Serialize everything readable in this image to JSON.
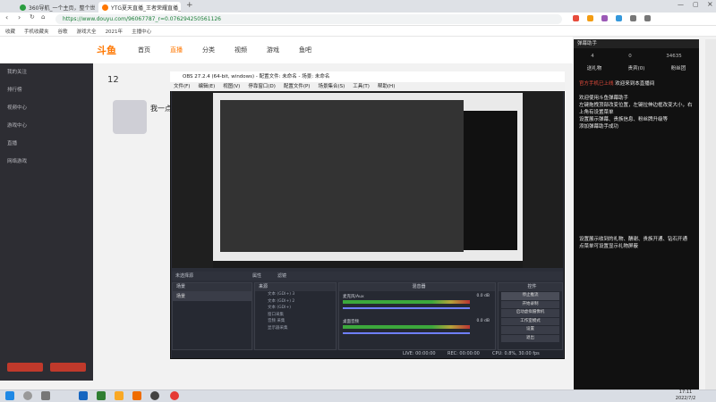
{
  "browser": {
    "tabs": [
      {
        "title": "360导航_一个主页，整个世界",
        "active": false
      },
      {
        "title": "YTG夏天直播_王者荣耀直播_",
        "active": true
      }
    ],
    "url": "https://www.douyu.com/96067787_r=0.076294250561126",
    "bookmarks": [
      "收藏",
      "手机收藏夹",
      "谷歌",
      "游戏大全",
      "2021年",
      "主播中心"
    ]
  },
  "douyu": {
    "logo": "斗鱼",
    "nav": [
      "首页",
      "直播",
      "分类",
      "视频",
      "游戏",
      "鱼吧"
    ],
    "left_menu": [
      "我的关注",
      "排行榜",
      "视频中心",
      "游戏中心",
      "直播",
      "网络游戏"
    ],
    "room_number": "12",
    "room_title": "我一点",
    "chat": {
      "title": "弹幕助手",
      "tabs": [
        "送礼物",
        "贵宾(0)",
        "粉丝团"
      ],
      "stats": [
        "4",
        "0",
        "34635"
      ],
      "alert": "官方手机已上线",
      "messages": [
        "欢迎来到本直播间",
        "欢迎使用斗鱼弹幕助手",
        "左键拖拽顶部改变位置，左键拉伸边框改变大小，右上角有设置菜单",
        "设置展示弹幕、贵族信息、粉丝牌升级等",
        "添加弹幕助手成功",
        "设置展示收到的礼物、酬谢、贵族开通、钻石开通",
        "点菜单可设置显示礼物屏蔽"
      ]
    }
  },
  "obs": {
    "title": "OBS 27.2.4 (64-bit, windows) - 配置文件: 未命名 - 场景: 未命名",
    "menu": [
      "文件(F)",
      "编辑(E)",
      "视图(V)",
      "停靠窗口(D)",
      "配置文件(P)",
      "场景集合(S)",
      "工具(T)",
      "帮助(H)"
    ],
    "panels": {
      "scenes": {
        "title": "场景",
        "items": [
          "场景"
        ]
      },
      "sources": {
        "title": "来源",
        "items": [
          "文本 (GDI+) 3",
          "文本 (GDI+) 2",
          "文本 (GDI+)",
          "窗口采集",
          "音频 采集",
          "显示器采集"
        ]
      },
      "mixer": {
        "title": "混音器",
        "channels": [
          "麦克风/Aux",
          "桌面音频"
        ],
        "db": [
          "0.0 dB",
          "0.0 dB"
        ]
      },
      "controls": {
        "title": "控件",
        "buttons": [
          "停止推流",
          "开始录制",
          "启动虚拟摄像机",
          "工作室模式",
          "设置",
          "退出"
        ]
      },
      "source_toolbar": {
        "a": "属性",
        "b": "滤镜"
      },
      "no_source": "未选择源"
    },
    "status": {
      "live": "LIVE: 00:00:00",
      "rec": "REC: 00:00:00",
      "cpu": "CPU: 0.8%, 30.00 fps"
    }
  },
  "taskbar": {
    "time": "17:11",
    "date": "2022/7/2"
  },
  "colors": {
    "brand": "#ff7700",
    "obs_bg": "#2b2e38",
    "chat_bg": "#111111",
    "live_green": "#3ca83c"
  }
}
